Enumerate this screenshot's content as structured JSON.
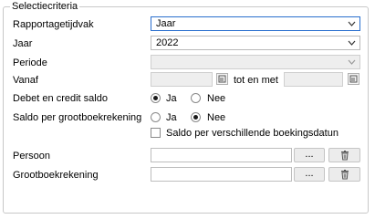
{
  "group": {
    "title": "Selectiecriteria"
  },
  "fields": {
    "rapportagetijdvak": {
      "label": "Rapportagetijdvak",
      "value": "Jaar"
    },
    "jaar": {
      "label": "Jaar",
      "value": "2022"
    },
    "periode": {
      "label": "Periode",
      "value": ""
    },
    "vanaf": {
      "label": "Vanaf",
      "tot_label": "tot en met"
    },
    "debet_credit": {
      "label": "Debet en credit saldo",
      "option_yes": "Ja",
      "option_no": "Nee",
      "selected": "Ja"
    },
    "saldo_grootboek": {
      "label": "Saldo per grootboekrekening",
      "option_yes": "Ja",
      "option_no": "Nee",
      "selected": "Nee"
    },
    "saldo_boekingsdatum": {
      "label": "Saldo per verschillende boekingsdatun",
      "checked": false
    },
    "persoon": {
      "label": "Persoon",
      "browse": "..."
    },
    "grootboekrekening": {
      "label": "Grootboekrekening",
      "browse": "..."
    }
  },
  "icons": {
    "chevron": "chevron-down-icon",
    "calendar": "calendar-icon",
    "trash": "trash-icon"
  },
  "colors": {
    "focus_border": "#2a6fce"
  }
}
